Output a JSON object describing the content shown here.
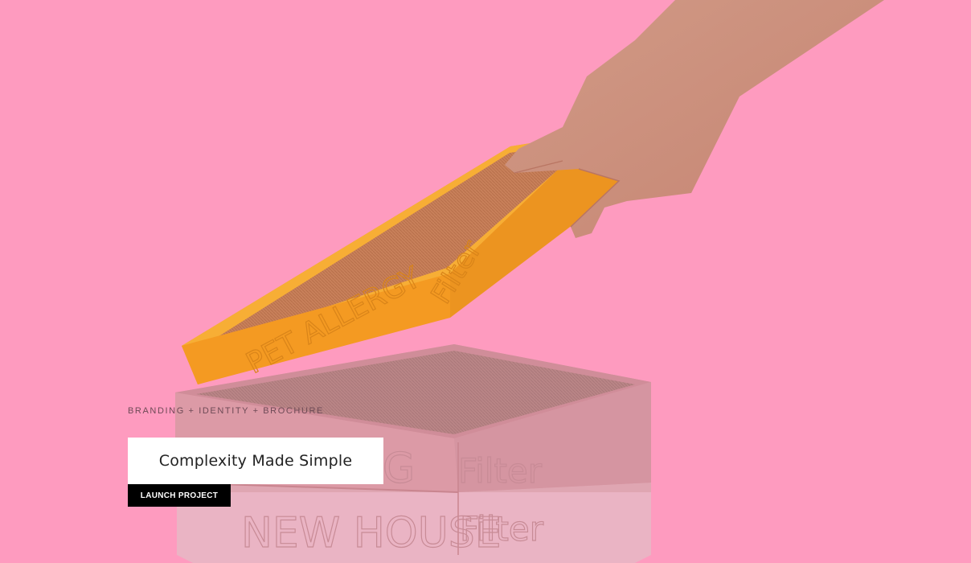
{
  "hero": {
    "category": "BRANDING + IDENTITY + BROCHURE",
    "title": "Complexity Made Simple",
    "cta_label": "LAUNCH PROJECT",
    "image": {
      "filter_top_label": "PET ALLERGY",
      "filter_top_word": "Filter",
      "filter_mid_label": "DOG",
      "filter_mid_word": "Filter",
      "filter_bottom_label": "NEW HOUSE",
      "filter_bottom_word": "Filter"
    }
  },
  "colors": {
    "background": "#fe9bbf",
    "filter_orange": "#f6a223",
    "filter_pink": "#dd9aa6",
    "button_bg": "#000000",
    "button_text": "#ffffff"
  }
}
